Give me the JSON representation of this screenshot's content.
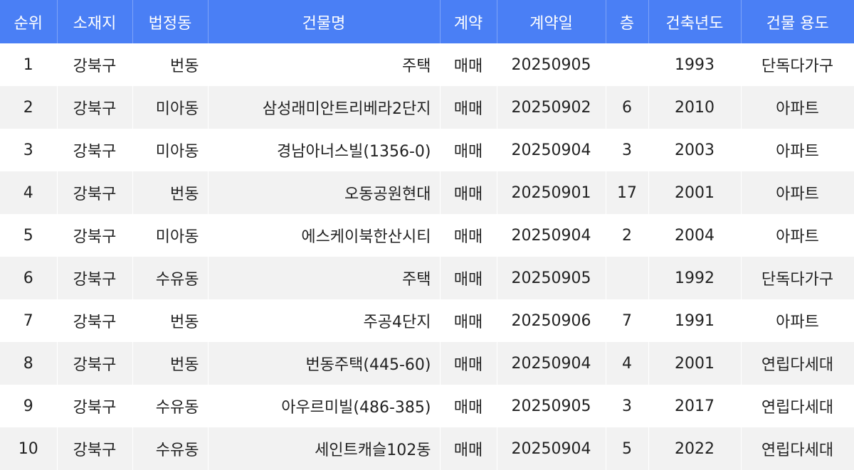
{
  "table": {
    "headers": [
      "순위",
      "소재지",
      "법정동",
      "건물명",
      "계약",
      "계약일",
      "층",
      "건축년도",
      "건물 용도"
    ],
    "rows": [
      [
        "1",
        "강북구",
        "번동",
        "주택",
        "매매",
        "20250905",
        "",
        "1993",
        "단독다가구"
      ],
      [
        "2",
        "강북구",
        "미아동",
        "삼성래미안트리베라2단지",
        "매매",
        "20250902",
        "6",
        "2010",
        "아파트"
      ],
      [
        "3",
        "강북구",
        "미아동",
        "경남아너스빌(1356-0)",
        "매매",
        "20250904",
        "3",
        "2003",
        "아파트"
      ],
      [
        "4",
        "강북구",
        "번동",
        "오동공원현대",
        "매매",
        "20250901",
        "17",
        "2001",
        "아파트"
      ],
      [
        "5",
        "강북구",
        "미아동",
        "에스케이북한산시티",
        "매매",
        "20250904",
        "2",
        "2004",
        "아파트"
      ],
      [
        "6",
        "강북구",
        "수유동",
        "주택",
        "매매",
        "20250905",
        "",
        "1992",
        "단독다가구"
      ],
      [
        "7",
        "강북구",
        "번동",
        "주공4단지",
        "매매",
        "20250906",
        "7",
        "1991",
        "아파트"
      ],
      [
        "8",
        "강북구",
        "번동",
        "번동주택(445-60)",
        "매매",
        "20250904",
        "4",
        "2001",
        "연립다세대"
      ],
      [
        "9",
        "강북구",
        "수유동",
        "아우르미빌(486-385)",
        "매매",
        "20250905",
        "3",
        "2017",
        "연립다세대"
      ],
      [
        "10",
        "강북구",
        "수유동",
        "세인트캐슬102동",
        "매매",
        "20250904",
        "5",
        "2022",
        "연립다세대"
      ]
    ]
  }
}
